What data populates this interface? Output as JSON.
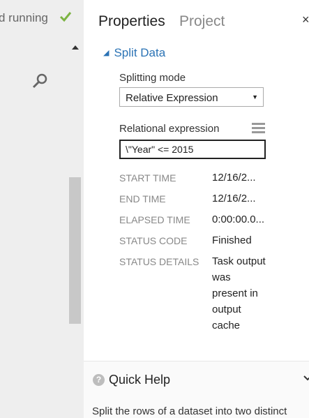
{
  "left_panel": {
    "run_status": "d running"
  },
  "tabs": {
    "properties": "Properties",
    "project": "Project"
  },
  "close_glyph": "×",
  "section": {
    "title": "Split Data"
  },
  "splitting_mode": {
    "label": "Splitting mode",
    "selected": "Relative Expression"
  },
  "relational_expression": {
    "label": "Relational expression",
    "value": "\\\"Year\" <= 2015"
  },
  "run_info": {
    "start_time_label": "START TIME",
    "start_time_value": "12/16/2...",
    "end_time_label": "END TIME",
    "end_time_value": "12/16/2...",
    "elapsed_time_label": "ELAPSED TIME",
    "elapsed_time_value": "0:00:00.0...",
    "status_code_label": "STATUS CODE",
    "status_code_value": "Finished",
    "status_details_label": "STATUS DETAILS",
    "status_details_value": "Task output was present in output cache"
  },
  "quick_help": {
    "title": "Quick Help",
    "text": "Split the rows of a dataset into two distinct"
  },
  "colors": {
    "accent": "#2b73b5",
    "success": "#7cb342"
  },
  "icons": [
    "check-icon",
    "collapse-up-icon",
    "search-icon",
    "close-icon",
    "menu-icon",
    "help-icon",
    "chevron-down-icon"
  ]
}
